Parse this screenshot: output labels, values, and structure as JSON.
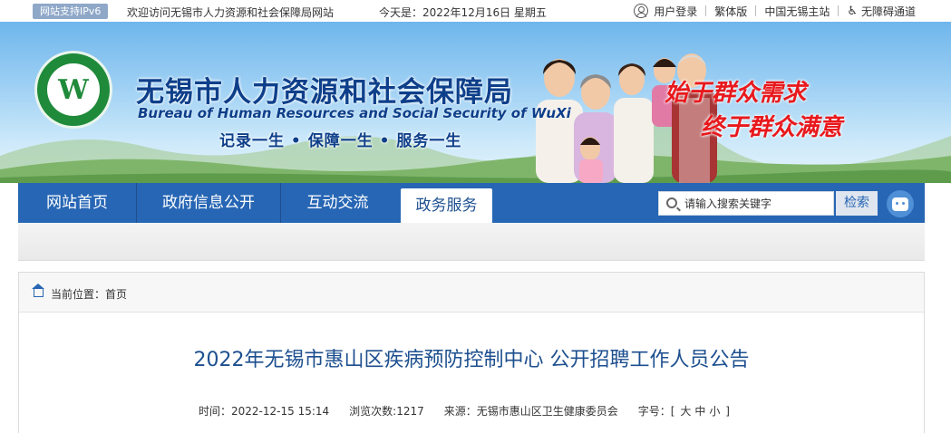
{
  "topbar": {
    "ipv6_badge": "网站支持IPv6",
    "welcome": "欢迎访问无锡市人力资源和社会保障局网站",
    "today_label": "今天是：",
    "today_value": "2022年12月16日 星期五",
    "links": {
      "login": "用户登录",
      "traditional": "繁体版",
      "wuxi_site": "中国无锡主站",
      "accessibility": "无障碍通道"
    }
  },
  "banner": {
    "title_cn": "无锡市人力资源和社会保障局",
    "title_en": "Bureau of Human Resources and Social Security of WuXi",
    "slogan": "记录一生 • 保障一生 • 服务一生",
    "motto_line1": "始于群众需求",
    "motto_line2": "终于群众满意",
    "logo_glyph": "W"
  },
  "nav": {
    "items": [
      {
        "label": "网站首页"
      },
      {
        "label": "政府信息公开"
      },
      {
        "label": "互动交流"
      },
      {
        "label": "政务服务"
      }
    ],
    "active_index": 3,
    "search_placeholder": "请输入搜索关键字",
    "search_button": "检索"
  },
  "breadcrumb": {
    "label": "当前位置：",
    "path": "首页"
  },
  "article": {
    "title": "2022年无锡市惠山区疾病预防控制中心 公开招聘工作人员公告",
    "meta": {
      "time_label": "时间：",
      "time_value": "2022-12-15 15:14",
      "views_label": "浏览次数:",
      "views_value": "1217",
      "source_label": "来源：",
      "source_value": "无锡市惠山区卫生健康委员会",
      "fontsize_label": "字号：",
      "fontsize_open": "[",
      "fontsize_large": "大",
      "fontsize_medium": "中",
      "fontsize_small": "小",
      "fontsize_close": "]"
    }
  },
  "colors": {
    "nav_blue": "#2766b4",
    "title_blue": "#1d4f8f",
    "motto_red": "#e8191d",
    "logo_green": "#1f8a3a"
  }
}
